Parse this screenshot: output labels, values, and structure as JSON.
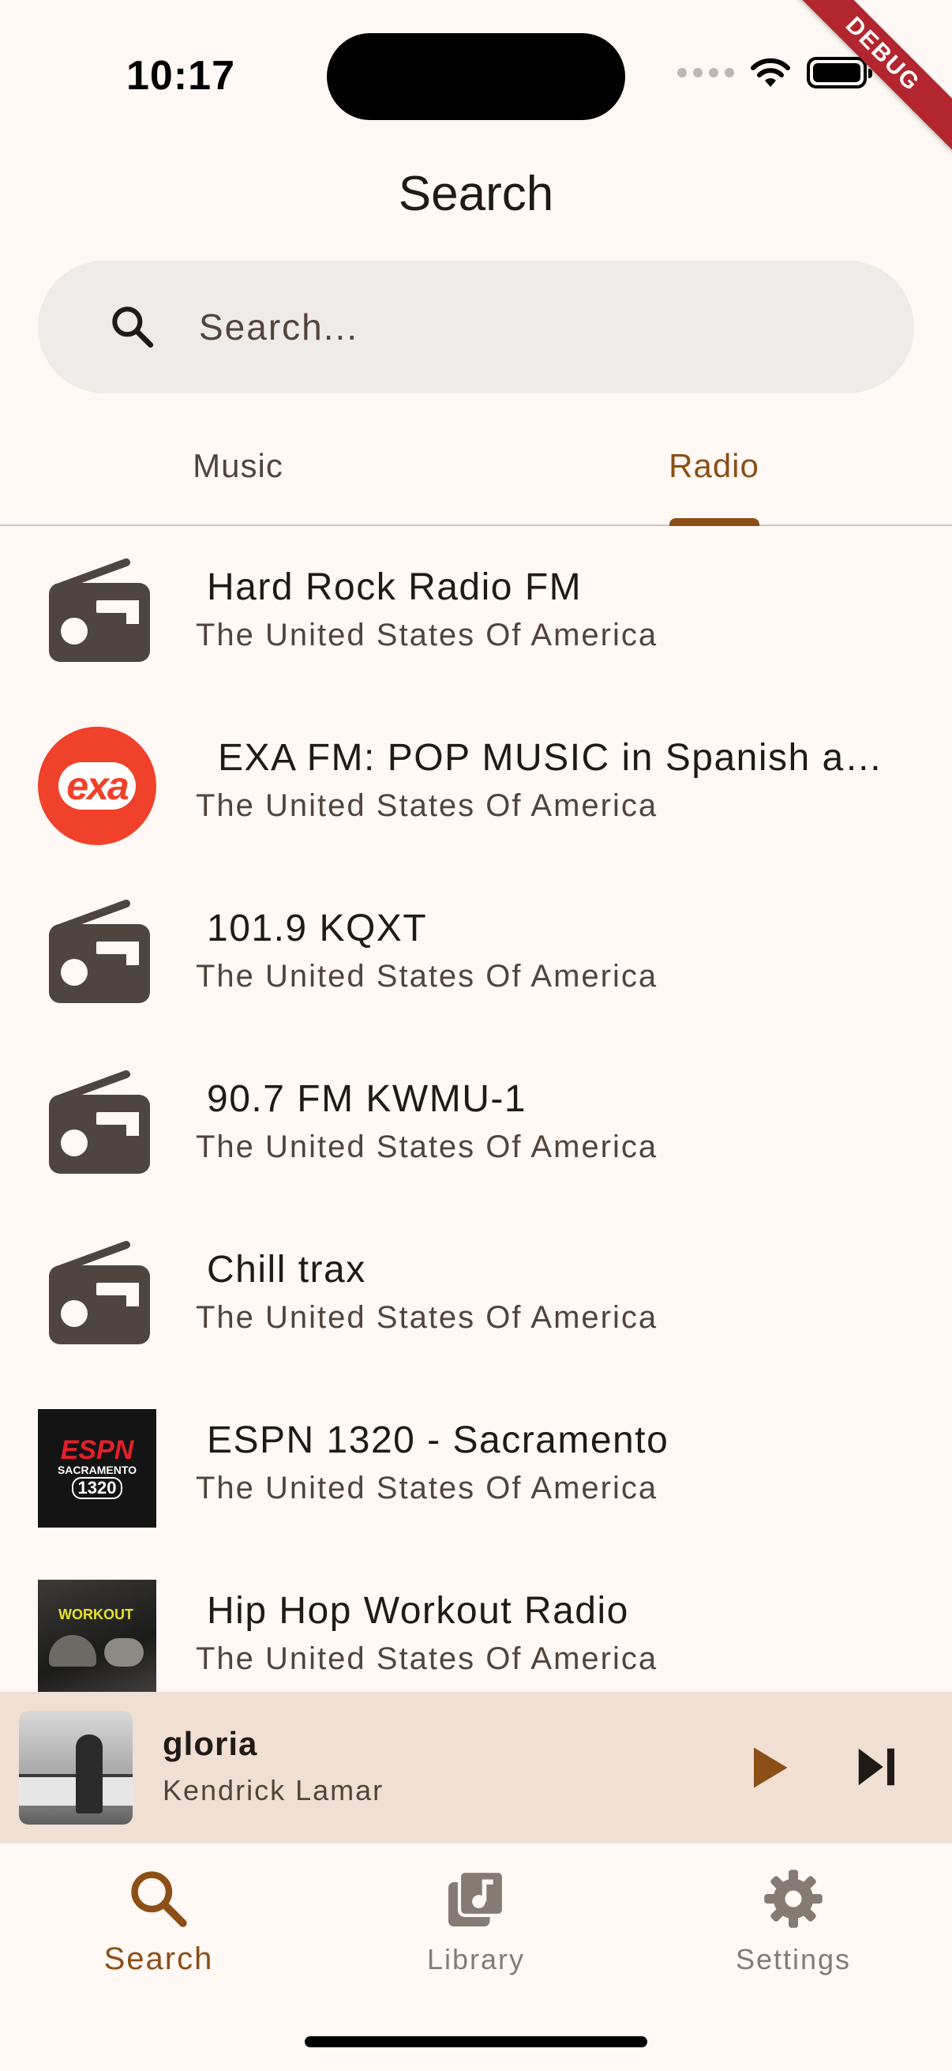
{
  "status_bar": {
    "time": "10:17"
  },
  "debug_banner": "DEBUG",
  "header": {
    "title": "Search"
  },
  "search": {
    "placeholder": "Search..."
  },
  "tabs": [
    {
      "label": "Music",
      "active": false
    },
    {
      "label": "Radio",
      "active": true
    }
  ],
  "stations": [
    {
      "title": "Hard Rock Radio FM",
      "country": "The United States Of America",
      "icon": "radio-icon"
    },
    {
      "title": "EXA FM: POP MUSIC in Spanish a…",
      "country": "The United States Of America",
      "icon": "exa-logo",
      "logo_text": "exa"
    },
    {
      "title": "101.9 KQXT",
      "country": "The United States Of America",
      "icon": "radio-icon"
    },
    {
      "title": "90.7 FM KWMU-1",
      "country": "The United States Of America",
      "icon": "radio-icon"
    },
    {
      "title": "Chill trax",
      "country": "The United States Of America",
      "icon": "radio-icon"
    },
    {
      "title": "ESPN 1320 - Sacramento",
      "country": "The United States Of America",
      "icon": "espn-logo",
      "logo_lines": [
        "ESPN",
        "SACRAMENTO",
        "1320"
      ]
    },
    {
      "title": "Hip Hop Workout Radio",
      "country": "The United States Of America",
      "icon": "workout-logo",
      "logo_text": "WORKOUT"
    }
  ],
  "now_playing": {
    "song": "gloria",
    "artist": "Kendrick Lamar"
  },
  "bottom_nav": [
    {
      "label": "Search",
      "icon": "search-icon",
      "active": true
    },
    {
      "label": "Library",
      "icon": "library-icon",
      "active": false
    },
    {
      "label": "Settings",
      "icon": "gear-icon",
      "active": false
    }
  ],
  "colors": {
    "accent": "#8b4f17",
    "background": "#fff8f5",
    "search_bar": "#efebe8",
    "mini_player": "#f1dfd3",
    "radio_icon": "#4e4440",
    "exa_red": "#f0412a"
  }
}
